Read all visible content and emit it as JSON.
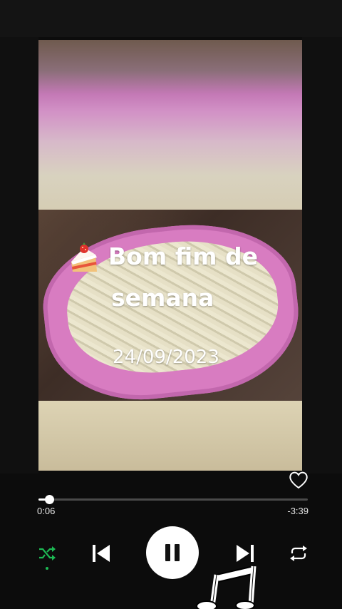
{
  "overlay": {
    "title_line1": "Bom fim de",
    "title_line2": "semana",
    "date": "24/09/2023"
  },
  "player": {
    "elapsed": "0:06",
    "remaining": "-3:39",
    "progress_fraction": 0.04,
    "shuffle_on": true,
    "is_playing": true
  },
  "icons": {
    "sticker": "cake-slice-icon",
    "like": "heart-icon",
    "shuffle": "shuffle-icon",
    "previous": "skip-previous-icon",
    "pause": "pause-icon",
    "next": "skip-next-icon",
    "repeat": "repeat-icon",
    "music": "music-note-icon"
  },
  "colors": {
    "background": "#0c0c0c",
    "accent": "#1db954",
    "bowl": "#d87cc1"
  }
}
